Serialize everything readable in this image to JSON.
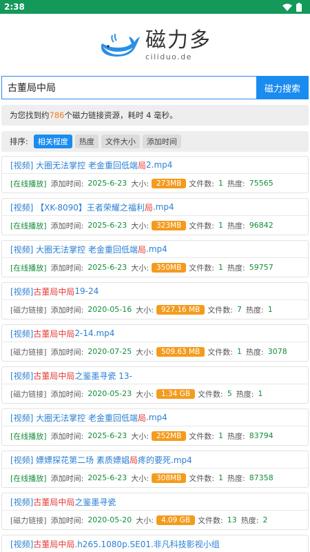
{
  "status": {
    "time": "2:38"
  },
  "logo": {
    "cn": "磁力多",
    "en": "ciliduo.de"
  },
  "search": {
    "value": "古董局中局",
    "button": "磁力搜索"
  },
  "info": {
    "prefix": "为您找到约",
    "count": "786",
    "suffix": "个磁力链接资源，耗时 4 毫秒。"
  },
  "sort": {
    "label": "排序:",
    "options": [
      "相关程度",
      "热度",
      "文件大小",
      "添加时间"
    ]
  },
  "labels": {
    "added": "添加时间:",
    "size": "大小:",
    "files": "文件数:",
    "heat": "热度:"
  },
  "results": [
    {
      "prefix": "[视频] 大圈无法掌控 老金重回低端",
      "hl": "局",
      "suffix": "2.mp4",
      "tag": "[在线播放]",
      "date": "2025-6-23",
      "size": "273MB",
      "files": "1",
      "heat": "75565"
    },
    {
      "prefix": "[视频] 【XK-8090】王者荣耀之福利",
      "hl": "局",
      "suffix": ".mp4",
      "tag": "[在线播放]",
      "date": "2025-6-23",
      "size": "323MB",
      "files": "1",
      "heat": "96842"
    },
    {
      "prefix": "[视频] 大圈无法掌控 老金重回低端",
      "hl": "局",
      "suffix": ".mp4",
      "tag": "[在线播放]",
      "date": "2025-6-23",
      "size": "350MB",
      "files": "1",
      "heat": "59757"
    },
    {
      "prefix": "[视频]",
      "hl": "古董局中局",
      "suffix": "19-24",
      "tag": "[磁力链接]",
      "date": "2020-05-16",
      "size": "927.16 MB",
      "files": "7",
      "heat": "1"
    },
    {
      "prefix": "[视频]",
      "hl": "古董局中局",
      "suffix": "2-14.mp4",
      "tag": "[磁力链接]",
      "date": "2020-07-25",
      "size": "509.63 MB",
      "files": "1",
      "heat": "3078"
    },
    {
      "prefix": "[视频]",
      "hl": "古董局中局",
      "suffix": "之鉴墨寻瓷 13-",
      "tag": "[磁力链接]",
      "date": "2020-05-23",
      "size": "1.34 GB",
      "files": "5",
      "heat": "1"
    },
    {
      "prefix": "[视频] 大圈无法掌控 老金重回低端",
      "hl": "局",
      "suffix": ".mp4",
      "tag": "[在线播放]",
      "date": "2025-6-23",
      "size": "252MB",
      "files": "1",
      "heat": "83794"
    },
    {
      "prefix": "[视频] 嫖嫖探花第二场 素质嫖娼",
      "hl": "局",
      "suffix": " 疼的要死.mp4",
      "tag": "[在线播放]",
      "date": "2025-6-23",
      "size": "308MB",
      "files": "1",
      "heat": "87358"
    },
    {
      "prefix": "[视频]",
      "hl": "古董局中局",
      "suffix": "之鉴墨寻瓷",
      "tag": "[磁力链接]",
      "date": "2020-05-20",
      "size": "4.09 GB",
      "files": "13",
      "heat": "2"
    },
    {
      "prefix": "[视频]",
      "hl": "古董局中局",
      "suffix": ".h265.1080p.SE01.非凡科技影视小组",
      "tag": "",
      "date": "",
      "size": "",
      "files": "",
      "heat": ""
    }
  ]
}
